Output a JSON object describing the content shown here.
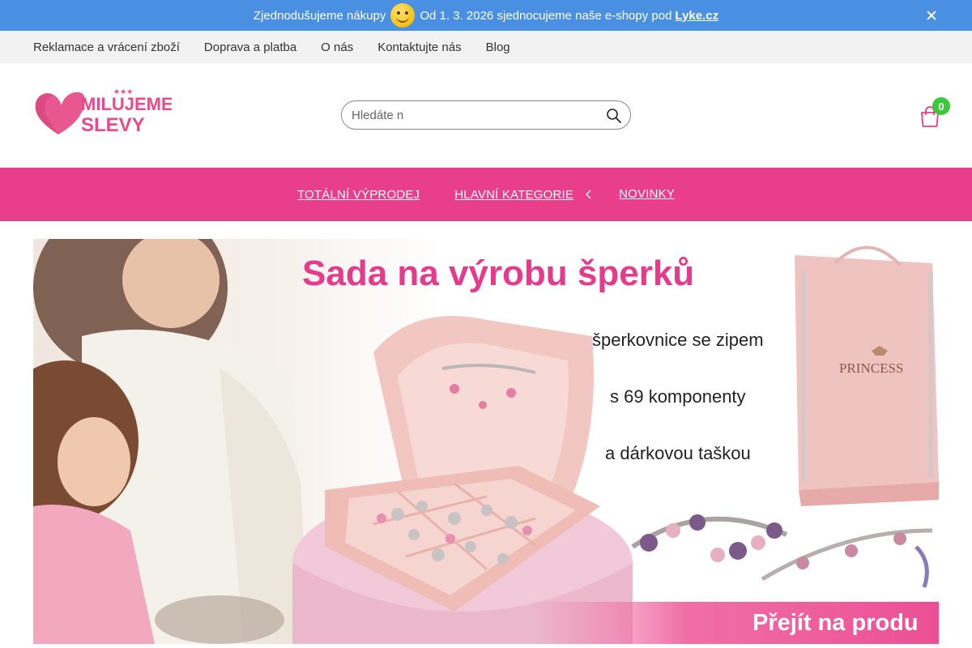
{
  "announcement": {
    "text_before": "Zjednodušujeme nákupy",
    "text_after": "Od 1. 3. 2026 sjednocujeme naše e-shopy pod",
    "link_label": "Lyke.cz"
  },
  "toplinks": [
    "Reklamace a vrácení zboží",
    "Doprava a platba",
    "O nás",
    "Kontaktujte nás",
    "Blog"
  ],
  "header": {
    "logo_text_line1": "MILUJEME",
    "logo_text_line2": "SLEVY",
    "search_placeholder": "Hledáte n",
    "cart_count": "0"
  },
  "nav": {
    "items": [
      "TOTÁLNÍ VÝPRODEJ",
      "HLAVNÍ KATEGORIE",
      "NOVINKY"
    ]
  },
  "banner": {
    "title": "Sada na výrobu šperků",
    "lines": [
      "šperkovnice se zipem",
      "s 69 komponenty",
      "a dárkovou taškou"
    ],
    "cta": "Přejít na produ",
    "bag_text": "PRINCESS"
  },
  "colors": {
    "announce": "#4a90e2",
    "nav": "#e83e8c",
    "accent": "#e43b8d",
    "badge": "#3cc83c"
  }
}
